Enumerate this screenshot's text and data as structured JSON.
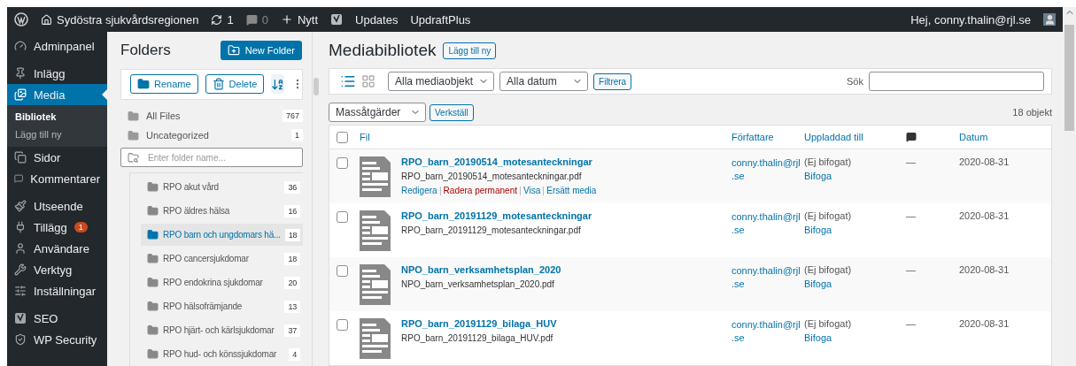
{
  "admin_bar": {
    "site": "Sydöstra sjukvårdsregionen",
    "updates": "1",
    "comments": "0",
    "new": "Nytt",
    "links": [
      "Updates",
      "UpdraftPlus"
    ],
    "greeting": "Hej, conny.thalin@rjl.se"
  },
  "sidebar": {
    "items": [
      {
        "label": "Adminpanel",
        "selected": false
      },
      {
        "label": "Inlägg",
        "selected": false
      },
      {
        "label": "Media",
        "selected": true,
        "submenu": [
          {
            "label": "Bibliotek",
            "selected": true
          },
          {
            "label": "Lägg till ny",
            "selected": false
          }
        ]
      },
      {
        "label": "Sidor",
        "selected": false
      },
      {
        "label": "Kommentarer",
        "selected": false
      },
      {
        "label": "Utseende",
        "selected": false
      },
      {
        "label": "Tillägg",
        "selected": false,
        "badge": "1"
      },
      {
        "label": "Användare",
        "selected": false
      },
      {
        "label": "Verktyg",
        "selected": false
      },
      {
        "label": "Inställningar",
        "selected": false
      },
      {
        "label": "SEO",
        "selected": false
      },
      {
        "label": "WP Security",
        "selected": false
      }
    ]
  },
  "folders": {
    "title": "Folders",
    "new_button": "New Folder",
    "rename": "Rename",
    "delete": "Delete",
    "search": {
      "placeholder": "Enter folder name..."
    },
    "special": [
      {
        "label": "All Files",
        "count": "767"
      },
      {
        "label": "Uncategorized",
        "count": "1"
      }
    ],
    "tree": [
      {
        "label": "RPO akut vård",
        "count": "36",
        "selected": false
      },
      {
        "label": "RPO äldres hälsa",
        "count": "16",
        "selected": false
      },
      {
        "label": "RPO barn och ungdomars hä...",
        "count": "18",
        "selected": true
      },
      {
        "label": "RPO cancersjukdomar",
        "count": "18",
        "selected": false
      },
      {
        "label": "RPO endokrina sjukdomar",
        "count": "20",
        "selected": false
      },
      {
        "label": "RPO hälsofrämjande",
        "count": "13",
        "selected": false
      },
      {
        "label": "RPO hjärt- och kärlsjukdomar",
        "count": "37",
        "selected": false
      },
      {
        "label": "RPO hud- och könssjukdomar",
        "count": "4",
        "selected": false
      }
    ]
  },
  "media": {
    "title": "Mediabibliotek",
    "add_new": "Lägg till ny",
    "type_filter": "Alla mediaobjekt",
    "date_filter": "Alla datum",
    "filter_button": "Filtrera",
    "search_label": "Sök",
    "bulk": "Massåtgärder",
    "apply": "Verkställ",
    "count": "18 objekt",
    "columns": [
      "Fil",
      "Författare",
      "Uppladdad till",
      "Datum"
    ],
    "select_all": {
      "checked": false
    },
    "rows": [
      {
        "title": "RPO_barn_20190514_motesanteckningar",
        "filename": "RPO_barn_20190514_motesanteckningar.pdf",
        "author": "conny.thalin@rjl\n.se",
        "uploaded": "(Ej bifogat)",
        "attach": "Bifoga",
        "comments": "—",
        "date": "2020-08-31",
        "checked": false,
        "actions": [
          {
            "label": "Redigera",
            "kind": "normal"
          },
          {
            "label": "Radera permanent",
            "kind": "danger"
          },
          {
            "label": "Visa",
            "kind": "normal"
          },
          {
            "label": "Ersätt media",
            "kind": "normal"
          }
        ]
      },
      {
        "title": "RPO_barn_20191129_motesanteckningar",
        "filename": "RPO_barn_20191129_motesanteckningar.pdf",
        "author": "conny.thalin@rjl\n.se",
        "uploaded": "(Ej bifogat)",
        "attach": "Bifoga",
        "comments": "—",
        "date": "2020-08-31",
        "checked": false
      },
      {
        "title": "NPO_barn_verksamhetsplan_2020",
        "filename": "NPO_barn_verksamhetsplan_2020.pdf",
        "author": "conny.thalin@rjl\n.se",
        "uploaded": "(Ej bifogat)",
        "attach": "Bifoga",
        "comments": "—",
        "date": "2020-08-31",
        "checked": false
      },
      {
        "title": "RPO_barn_20191129_bilaga_HUV",
        "filename": "RPO_barn_20191129_bilaga_HUV.pdf",
        "author": "conny.thalin@rjl\n.se",
        "uploaded": "(Ej bifogat)",
        "attach": "Bifoga",
        "comments": "—",
        "date": "2020-08-31",
        "checked": false
      }
    ]
  }
}
